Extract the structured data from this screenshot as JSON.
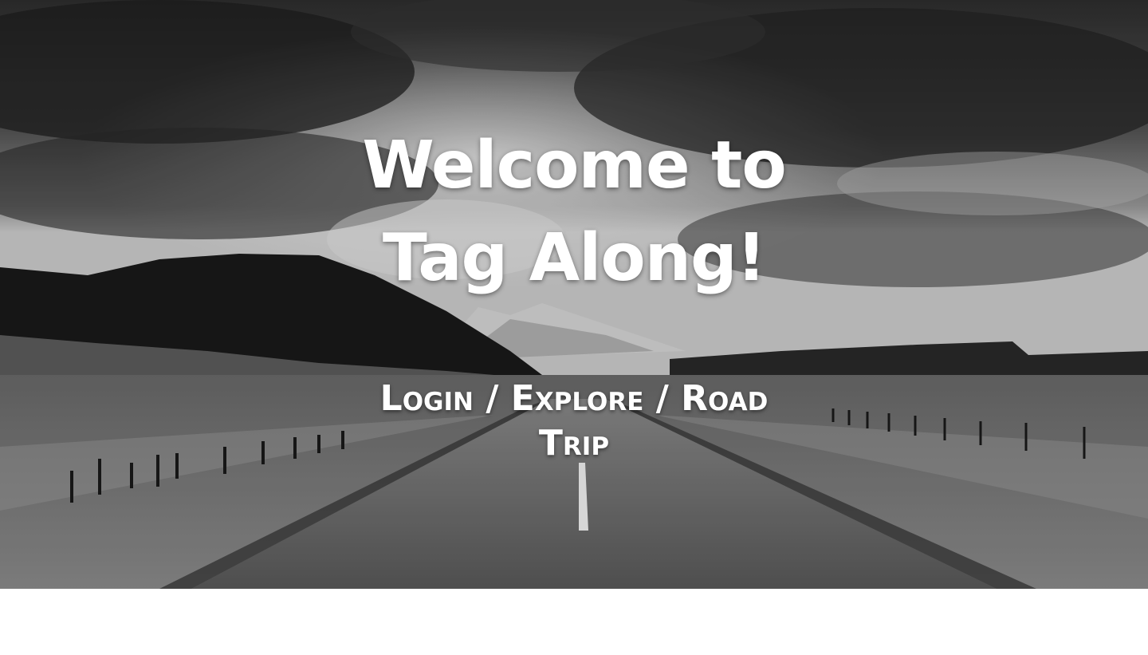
{
  "hero": {
    "title": "Welcome to Tag Along!",
    "nav": {
      "items": [
        {
          "label": "Login"
        },
        {
          "label": "Explore"
        },
        {
          "label": "Road Trip"
        }
      ],
      "separator": "/"
    }
  }
}
